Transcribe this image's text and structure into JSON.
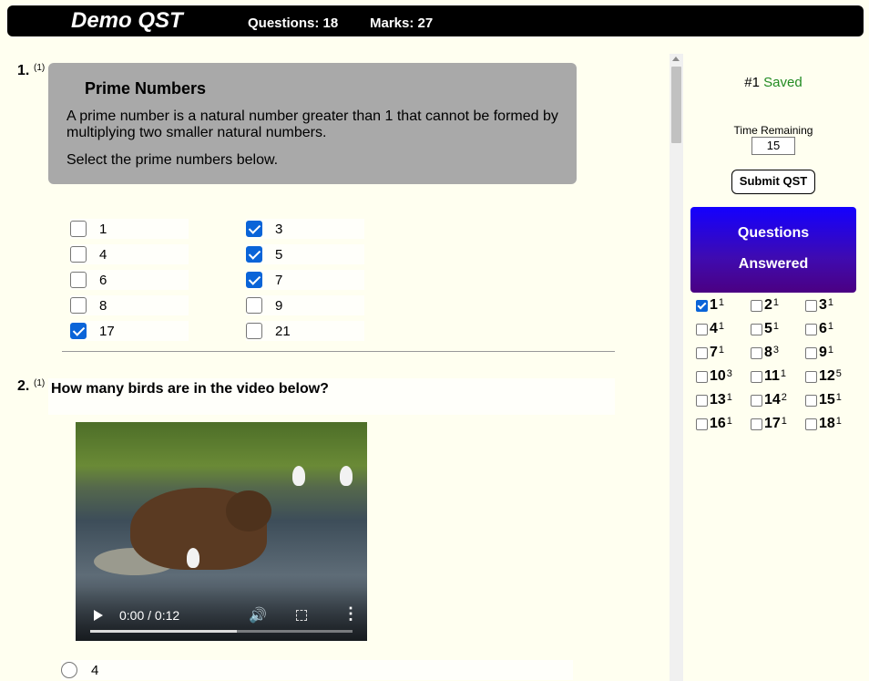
{
  "header": {
    "title": "Demo QST",
    "questions": "Questions: 18",
    "marks": "Marks: 27"
  },
  "q1": {
    "number": "1.",
    "marks": "(1)",
    "title": "Prime Numbers",
    "description": "A prime number is a natural number greater than 1 that cannot be formed by multiplying two smaller natural numbers.",
    "instruction": "Select the prime numbers below.",
    "options": [
      {
        "label": "1",
        "checked": false
      },
      {
        "label": "3",
        "checked": true
      },
      {
        "label": "4",
        "checked": false
      },
      {
        "label": "5",
        "checked": true
      },
      {
        "label": "6",
        "checked": false
      },
      {
        "label": "7",
        "checked": true
      },
      {
        "label": "8",
        "checked": false
      },
      {
        "label": "9",
        "checked": false
      },
      {
        "label": "17",
        "checked": true
      },
      {
        "label": "21",
        "checked": false
      }
    ]
  },
  "q2": {
    "number": "2.",
    "marks": "(1)",
    "title": "How many birds are in the video below?",
    "video": {
      "time": "0:00 / 0:12",
      "progress": 0.56
    },
    "options": [
      {
        "label": "4",
        "checked": false
      }
    ]
  },
  "sidebar": {
    "saved_num": "#1",
    "saved_word": "Saved",
    "time_label": "Time Remaining",
    "time_value": "15",
    "submit_label": "Submit QST",
    "qa_line1": "Questions",
    "qa_line2": "Answered",
    "answered": [
      {
        "num": "1",
        "marks": "1",
        "checked": true
      },
      {
        "num": "2",
        "marks": "1",
        "checked": false
      },
      {
        "num": "3",
        "marks": "1",
        "checked": false
      },
      {
        "num": "4",
        "marks": "1",
        "checked": false
      },
      {
        "num": "5",
        "marks": "1",
        "checked": false
      },
      {
        "num": "6",
        "marks": "1",
        "checked": false
      },
      {
        "num": "7",
        "marks": "1",
        "checked": false
      },
      {
        "num": "8",
        "marks": "3",
        "checked": false
      },
      {
        "num": "9",
        "marks": "1",
        "checked": false
      },
      {
        "num": "10",
        "marks": "3",
        "checked": false
      },
      {
        "num": "11",
        "marks": "1",
        "checked": false
      },
      {
        "num": "12",
        "marks": "5",
        "checked": false
      },
      {
        "num": "13",
        "marks": "1",
        "checked": false
      },
      {
        "num": "14",
        "marks": "2",
        "checked": false
      },
      {
        "num": "15",
        "marks": "1",
        "checked": false
      },
      {
        "num": "16",
        "marks": "1",
        "checked": false
      },
      {
        "num": "17",
        "marks": "1",
        "checked": false
      },
      {
        "num": "18",
        "marks": "1",
        "checked": false
      }
    ]
  }
}
